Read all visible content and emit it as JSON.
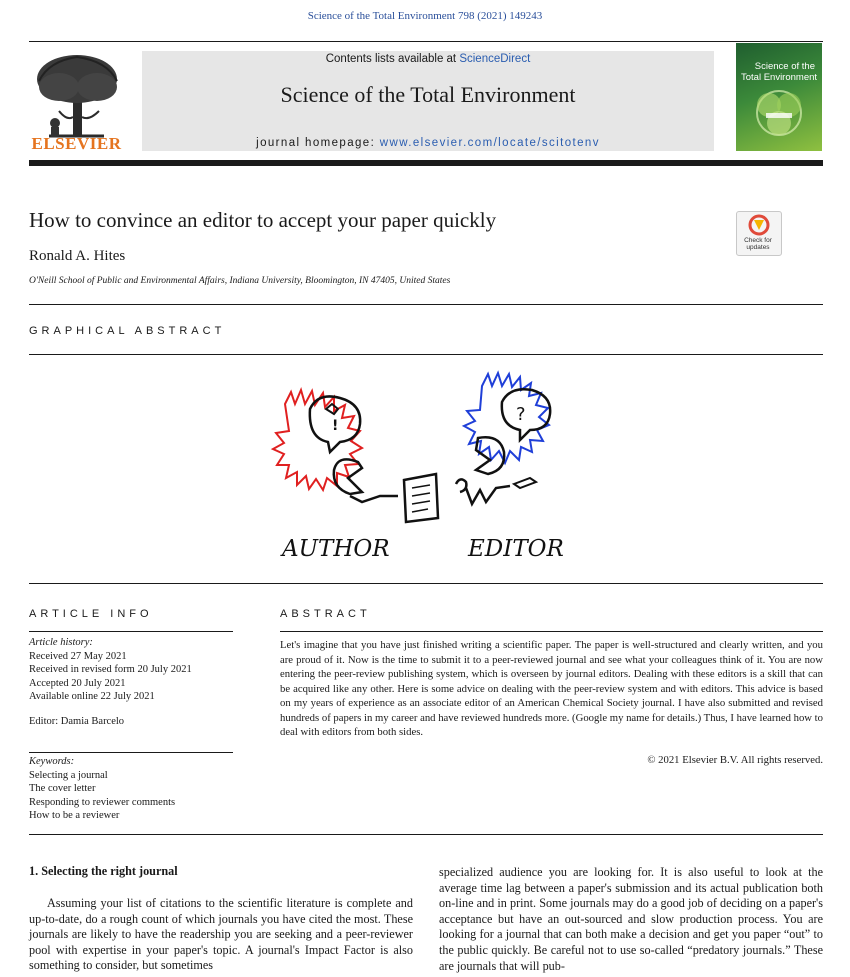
{
  "journal_citation": "Science of the Total Environment 798 (2021) 149243",
  "header": {
    "contents_prefix": "Contents lists available at ",
    "contents_link": "ScienceDirect",
    "journal_name": "Science of the Total Environment",
    "homepage_prefix": "journal homepage: ",
    "homepage_url": "www.elsevier.com/locate/scitotenv",
    "publisher": "ELSEVIER",
    "cover_title_line1": "Science of the",
    "cover_title_line2": "Total Environment"
  },
  "check_updates": {
    "line1": "Check for",
    "line2": "updates"
  },
  "article": {
    "title": "How to convince an editor to accept your paper quickly",
    "author": "Ronald A. Hites",
    "affiliation": "O'Neill School of Public and Environmental Affairs, Indiana University, Bloomington, IN 47405, United States"
  },
  "graphical_abstract": {
    "heading": "GRAPHICAL ABSTRACT",
    "label_author": "AUTHOR",
    "label_editor": "EDITOR"
  },
  "article_info": {
    "heading": "ARTICLE INFO",
    "history_label": "Article history:",
    "history": [
      "Received 27 May 2021",
      "Received in revised form 20 July 2021",
      "Accepted 20 July 2021",
      "Available online 22 July 2021"
    ],
    "editor": "Editor: Damia Barcelo",
    "keywords_label": "Keywords:",
    "keywords": [
      "Selecting a journal",
      "The cover letter",
      "Responding to reviewer comments",
      "How to be a reviewer"
    ]
  },
  "abstract": {
    "heading": "ABSTRACT",
    "text": "Let's imagine that you have just finished writing a scientific paper. The paper is well-structured and clearly written, and you are proud of it. Now is the time to submit it to a peer-reviewed journal and see what your colleagues think of it. You are now entering the peer-review publishing system, which is overseen by journal editors. Dealing with these editors is a skill that can be acquired like any other. Here is some advice on dealing with the peer-review system and with editors. This advice is based on my years of experience as an associate editor of an American Chemical Society journal. I have also submitted and revised hundreds of papers in my career and have reviewed hundreds more. (Google my name for details.) Thus, I have learned how to deal with editors from both sides.",
    "copyright": "© 2021 Elsevier B.V. All rights reserved."
  },
  "body": {
    "section_heading": "1. Selecting the right journal",
    "col1": "Assuming your list of citations to the scientific literature is complete and up-to-date, do a rough count of which journals you have cited the most. These journals are likely to have the readership you are seeking and a peer-reviewer pool with expertise in your paper's topic. A journal's Impact Factor is also something to consider, but sometimes",
    "col2": "specialized audience you are looking for. It is also useful to look at the average time lag between a paper's submission and its actual publication both on-line and in print. Some journals may do a good job of deciding on a paper's acceptance but have an out-sourced and slow production process. You are looking for a journal that can both make a decision and get you paper “out” to the public quickly. Be careful not to use so-called “predatory journals.” These are journals that will pub-"
  },
  "colors": {
    "link": "#2a5db0",
    "publisher_orange": "#e5741f",
    "author_bubble": "#e02020",
    "editor_bubble": "#1f3fd8"
  }
}
